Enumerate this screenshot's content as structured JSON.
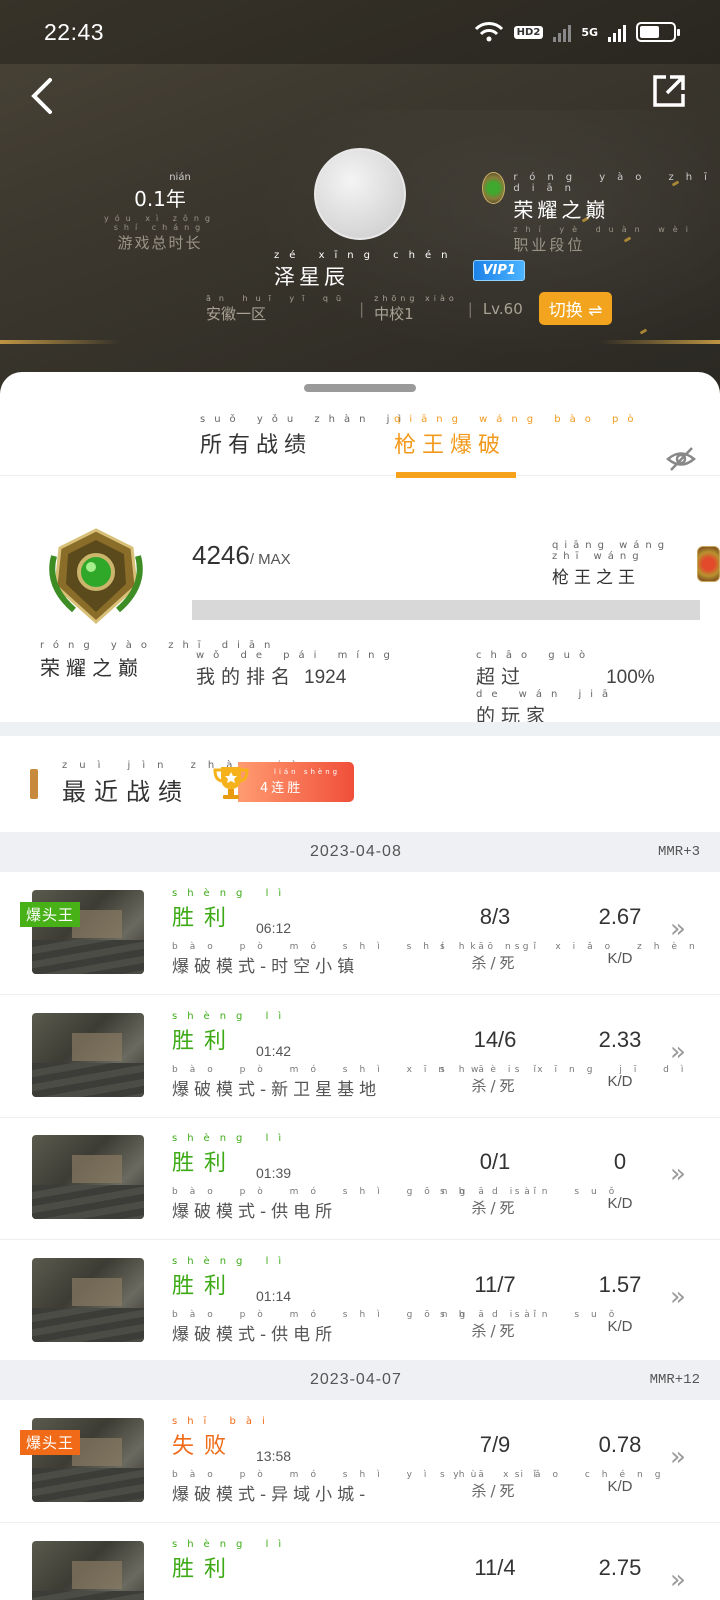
{
  "status_bar": {
    "time": "22:43",
    "hd_label": "HD2",
    "network": "5G"
  },
  "profile": {
    "play_time_value": "0.1年",
    "play_time_pinyin": "nián",
    "play_time_label": "游戏总时长",
    "play_time_label_pinyin": "yóu xì zǒng shí cháng",
    "name": "泽星辰",
    "name_pinyin": "zé xīng chén",
    "vip": "VIP1",
    "rank_value": "荣耀之巅",
    "rank_value_pinyin": "róng yào zhī diān",
    "rank_label": "职业段位",
    "rank_label_pinyin": "zhí yè duàn wèi",
    "server": "安徽一区",
    "server_pinyin": "ān huī yī qū",
    "grade": "中校1",
    "grade_pinyin": "zhōng xiào",
    "level": "Lv.60",
    "switch_label": "切换 ⇌"
  },
  "tabs": [
    {
      "label": "所有战绩",
      "pinyin": "suǒ yǒu zhàn jì",
      "active": false
    },
    {
      "label": "枪王爆破",
      "pinyin": "qiāng wáng bào pò",
      "active": true
    }
  ],
  "rank_card": {
    "tier_name": "荣耀之巅",
    "tier_pinyin": "róng yào zhī diān",
    "score": "4246",
    "score_suffix": "/ MAX",
    "king_label": "枪王之王",
    "king_pinyin": "qiāng wáng zhī wáng",
    "progress_fraction": 0,
    "my_rank_label": "我的排名",
    "my_rank_pinyin": "wǒ de pái míng",
    "my_rank_value": "1924",
    "beat_label_1": "超过",
    "beat_pinyin_1": "chāo guò",
    "beat_value": "100%",
    "beat_label_2": "的玩家",
    "beat_pinyin_2": "de wán jiā"
  },
  "recent": {
    "title": "最近战绩",
    "title_pinyin": "zuì jìn zhàn jì",
    "streak_label": "4连胜",
    "streak_pinyin": "lián shèng"
  },
  "days": [
    {
      "date": "2023-04-08",
      "mmr": "MMR+3",
      "matches": [
        {
          "tag": "爆头王",
          "tag_color": "#49b118",
          "result": "胜利",
          "result_pinyin": "shèng lì",
          "win": true,
          "duration": "06:12",
          "mode": "爆破模式-时空小镇",
          "mode_pinyin": "bào pò mó shì shí kōng xiǎo zhèn",
          "kd": "8/3",
          "kd_label": "杀/死",
          "kd_pinyin": "shā sǐ",
          "ratio": "2.67",
          "ratio_label": "K/D"
        },
        {
          "tag": "",
          "result": "胜利",
          "result_pinyin": "shèng lì",
          "win": true,
          "duration": "01:42",
          "mode": "爆破模式-新卫星基地",
          "mode_pinyin": "bào pò mó shì xīn wèi xīng jī dì",
          "kd": "14/6",
          "kd_label": "杀/死",
          "kd_pinyin": "shā sǐ",
          "ratio": "2.33",
          "ratio_label": "K/D"
        },
        {
          "tag": "",
          "result": "胜利",
          "result_pinyin": "shèng lì",
          "win": true,
          "duration": "01:39",
          "mode": "爆破模式-供电所",
          "mode_pinyin": "bào pò mó shì gōng diàn suǒ",
          "kd": "0/1",
          "kd_label": "杀/死",
          "kd_pinyin": "shā sǐ",
          "ratio": "0",
          "ratio_label": "K/D"
        },
        {
          "tag": "",
          "result": "胜利",
          "result_pinyin": "shèng lì",
          "win": true,
          "duration": "01:14",
          "mode": "爆破模式-供电所",
          "mode_pinyin": "bào pò mó shì gōng diàn suǒ",
          "kd": "11/7",
          "kd_label": "杀/死",
          "kd_pinyin": "shā sǐ",
          "ratio": "1.57",
          "ratio_label": "K/D"
        }
      ]
    },
    {
      "date": "2023-04-07",
      "mmr": "MMR+12",
      "matches": [
        {
          "tag": "爆头王",
          "tag_color": "#f06a17",
          "result": "失败",
          "result_pinyin": "shī bài",
          "win": false,
          "duration": "13:58",
          "mode": "爆破模式-异域小城-",
          "mode_pinyin": "bào pò mó shì yì yù xiǎo chéng",
          "kd": "7/9",
          "kd_label": "杀/死",
          "kd_pinyin": "shā sǐ",
          "ratio": "0.78",
          "ratio_label": "K/D"
        },
        {
          "tag": "",
          "result": "胜利",
          "result_pinyin": "shèng lì",
          "win": true,
          "duration": "",
          "mode": "",
          "mode_pinyin": "",
          "kd": "11/4",
          "kd_label": "",
          "kd_pinyin": "",
          "ratio": "2.75",
          "ratio_label": ""
        }
      ]
    }
  ],
  "colors": {
    "accent": "#f39a1d",
    "win": "#3daa16",
    "lose": "#f06a17"
  }
}
